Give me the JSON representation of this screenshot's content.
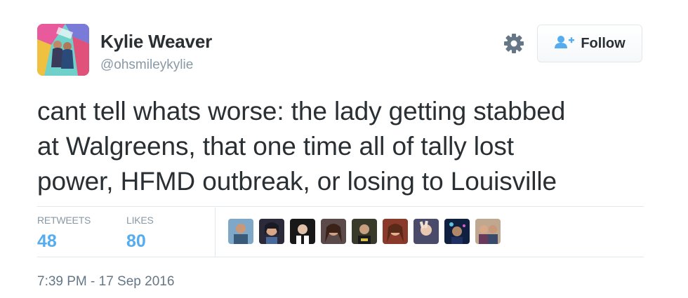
{
  "user": {
    "name": "Kylie Weaver",
    "handle": "@ohsmileykylie"
  },
  "actions": {
    "follow_label": "Follow",
    "settings_icon": "gear-icon",
    "follow_icon": "person-add-icon"
  },
  "tweet": {
    "text_lines": [
      "cant tell whats worse: the lady getting stabbed",
      "at Walgreens, that one time all of tally lost",
      "power, HFMD outbreak, or losing to Louisville"
    ],
    "timestamp": "7:39 PM - 17 Sep 2016"
  },
  "stats": {
    "retweets_label": "RETWEETS",
    "retweets_count": "48",
    "likes_label": "LIKES",
    "likes_count": "80"
  },
  "likers_count_shown": 9,
  "colors": {
    "accent": "#55acee",
    "text": "#292f33",
    "muted": "#8899a6",
    "border": "#e1e8ed"
  }
}
